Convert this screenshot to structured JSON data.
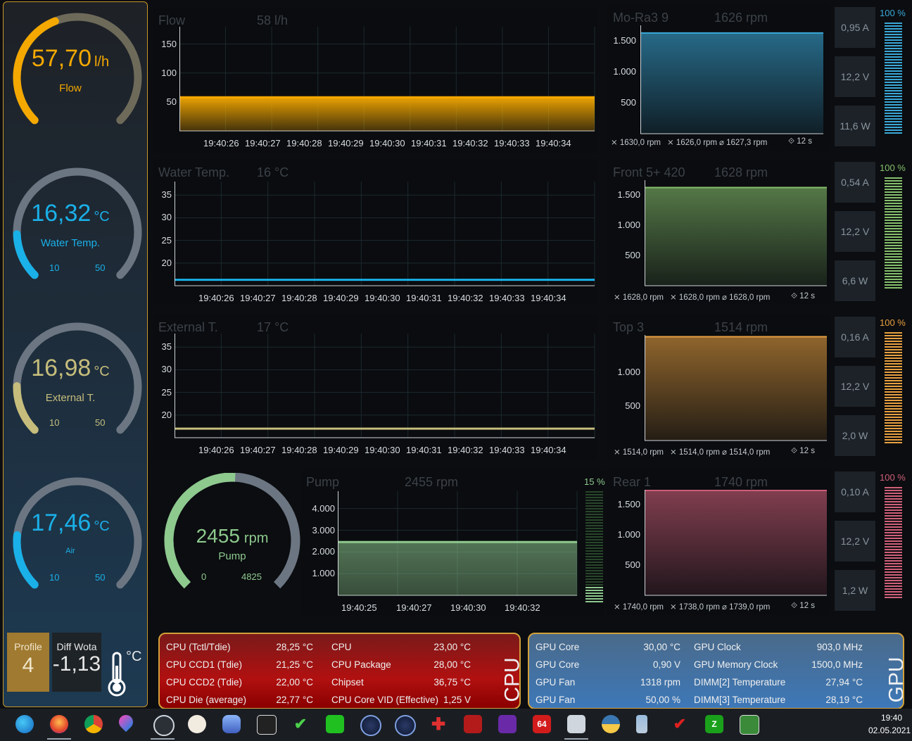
{
  "colors": {
    "flow": "#f4a800",
    "water": "#1ab0e8",
    "external": "#c6bd7c",
    "air": "#1ab0e8",
    "pump": "#8ec98e",
    "mora": "#3aa8d8",
    "front": "#86c06c",
    "top": "#e8a040",
    "rear": "#d0607a",
    "frame": "#c8962a"
  },
  "gauges": [
    {
      "value": "57,70",
      "unit": "l/h",
      "label": "Flow",
      "min": "",
      "max": "",
      "fill": 0.42
    },
    {
      "value": "16,32",
      "unit": "°C",
      "label": "Water Temp.",
      "min": "10",
      "max": "50",
      "fill": 0.16
    },
    {
      "value": "16,98",
      "unit": "°C",
      "label": "External T.",
      "min": "10",
      "max": "50",
      "fill": 0.17
    },
    {
      "value": "17,46",
      "unit": "°C",
      "label": "Air",
      "min": "10",
      "max": "50",
      "fill": 0.19
    }
  ],
  "profile": {
    "label": "Profile",
    "value": "4"
  },
  "diff": {
    "label": "Diff Wota",
    "value": "-1,13",
    "unit": "°C"
  },
  "time_ticks": [
    "19:40:26",
    "19:40:27",
    "19:40:28",
    "19:40:29",
    "19:40:30",
    "19:40:31",
    "19:40:32",
    "19:40:33",
    "19:40:34"
  ],
  "pump_time_ticks": [
    "19:40:25",
    "19:40:27",
    "19:40:30",
    "19:40:32"
  ],
  "chart_data": [
    {
      "type": "area",
      "title": "Flow",
      "current": "58 l/h",
      "ylim": [
        0,
        180
      ],
      "yticks": [
        "150",
        "100",
        "50"
      ],
      "values": [
        58,
        58,
        58,
        58,
        58,
        58,
        58,
        58,
        58
      ]
    },
    {
      "type": "line",
      "title": "Water Temp.",
      "current": "16 °C",
      "ylim": [
        15,
        38
      ],
      "yticks": [
        "35",
        "30",
        "25",
        "20"
      ],
      "values": [
        16.3,
        16.3,
        16.3,
        16.3,
        16.3,
        16.3,
        16.3,
        16.3,
        16.3
      ]
    },
    {
      "type": "line",
      "title": "External T.",
      "current": "17 °C",
      "ylim": [
        15,
        38
      ],
      "yticks": [
        "35",
        "30",
        "25",
        "20"
      ],
      "values": [
        17,
        17,
        17,
        17,
        17,
        17,
        17,
        17,
        17
      ]
    },
    {
      "type": "area",
      "title": "Pump",
      "current": "2455 rpm",
      "ylim": [
        0,
        4800
      ],
      "yticks": [
        "4.000",
        "3.000",
        "2.000",
        "1.000"
      ],
      "values": [
        2455,
        2455,
        2455,
        2455
      ]
    }
  ],
  "fans": [
    {
      "name": "Mo-Ra3 9",
      "rpm": "1626 rpm",
      "yticks": [
        "1.500",
        "1.000",
        "500"
      ],
      "value": 1626,
      "ylim": [
        0,
        1750
      ],
      "stats": [
        "⨯ 1630,0 rpm",
        "⨯ 1626,0 rpm",
        "⌀ 1627,3 rpm",
        "⟐ 12 s"
      ],
      "amps": "0,95 A",
      "volts": "12,2 V",
      "watts": "11,6 W",
      "percent": "100 %"
    },
    {
      "name": "Front 5+ 420",
      "rpm": "1628 rpm",
      "yticks": [
        "1.500",
        "1.000",
        "500"
      ],
      "value": 1628,
      "ylim": [
        0,
        1750
      ],
      "stats": [
        "⨯ 1628,0 rpm",
        "⨯ 1628,0 rpm",
        "⌀ 1628,0 rpm",
        "⟐ 12 s"
      ],
      "amps": "0,54 A",
      "volts": "12,2 V",
      "watts": "6,6 W",
      "percent": "100 %"
    },
    {
      "name": "Top 3",
      "rpm": "1514 rpm",
      "yticks": [
        "1.000",
        "500"
      ],
      "value": 1514,
      "ylim": [
        0,
        1540
      ],
      "stats": [
        "⨯ 1514,0 rpm",
        "⨯ 1514,0 rpm",
        "⌀ 1514,0 rpm",
        "⟐ 12 s"
      ],
      "amps": "0,16 A",
      "volts": "12,2 V",
      "watts": "2,0 W",
      "percent": "100 %"
    },
    {
      "name": "Rear 1",
      "rpm": "1740 rpm",
      "yticks": [
        "1.500",
        "1.000",
        "500"
      ],
      "value": 1740,
      "ylim": [
        0,
        1750
      ],
      "stats": [
        "⨯ 1740,0 rpm",
        "⨯ 1738,0 rpm",
        "⌀ 1739,0 rpm",
        "⟐ 12 s"
      ],
      "amps": "0,10 A",
      "volts": "12,2 V",
      "watts": "1,2 W",
      "percent": "100 %"
    }
  ],
  "pump": {
    "value": "2455",
    "unit": "rpm",
    "label": "Pump",
    "min": "0",
    "max": "4825",
    "fill": 0.51,
    "percent": "15 %",
    "level": 0.15
  },
  "cpu": {
    "title": "CPU",
    "left": [
      [
        "CPU (Tctl/Tdie)",
        "28,25 °C"
      ],
      [
        "CPU CCD1 (Tdie)",
        "21,25 °C"
      ],
      [
        "CPU CCD2 (Tdie)",
        "22,00 °C"
      ],
      [
        "CPU Die (average)",
        "22,77 °C"
      ]
    ],
    "right": [
      [
        "CPU",
        "23,00 °C"
      ],
      [
        "CPU Package",
        "28,00 °C"
      ],
      [
        "Chipset",
        "36,75 °C"
      ],
      [
        "CPU Core VID (Effective)",
        "1,25 V"
      ]
    ]
  },
  "gpu": {
    "title": "GPU",
    "left": [
      [
        "GPU Core",
        "30,00 °C"
      ],
      [
        "GPU Core",
        "0,90 V"
      ],
      [
        "GPU Fan",
        "1318 rpm"
      ],
      [
        "GPU Fan",
        "50,00 %"
      ]
    ],
    "right": [
      [
        "GPU Clock",
        "903,0 MHz"
      ],
      [
        "GPU Memory Clock",
        "1500,0 MHz"
      ],
      [
        "DIMM[2] Temperature",
        "27,94 °C"
      ],
      [
        "DIMM[3] Temperature",
        "28,19 °C"
      ]
    ]
  },
  "taskbar": {
    "icons": [
      "edge-icon",
      "firefox-icon",
      "chrome-icon",
      "droplet-icon",
      "lock-icon",
      "compass-icon",
      "cloud-icon",
      "abacus-icon",
      "checkmark-icon",
      "calc-icon",
      "cinema-icon",
      "cinema2-icon",
      "cross-icon",
      "amd-icon",
      "chip-icon",
      "aida64-icon",
      "aquasuite-icon",
      "python-icon",
      "bottle-icon",
      "msi-icon",
      "z-icon",
      "gpu-card-icon"
    ],
    "aida_label": "64",
    "z_label": "Z",
    "time": "19:40",
    "date": "02.05.2021"
  }
}
